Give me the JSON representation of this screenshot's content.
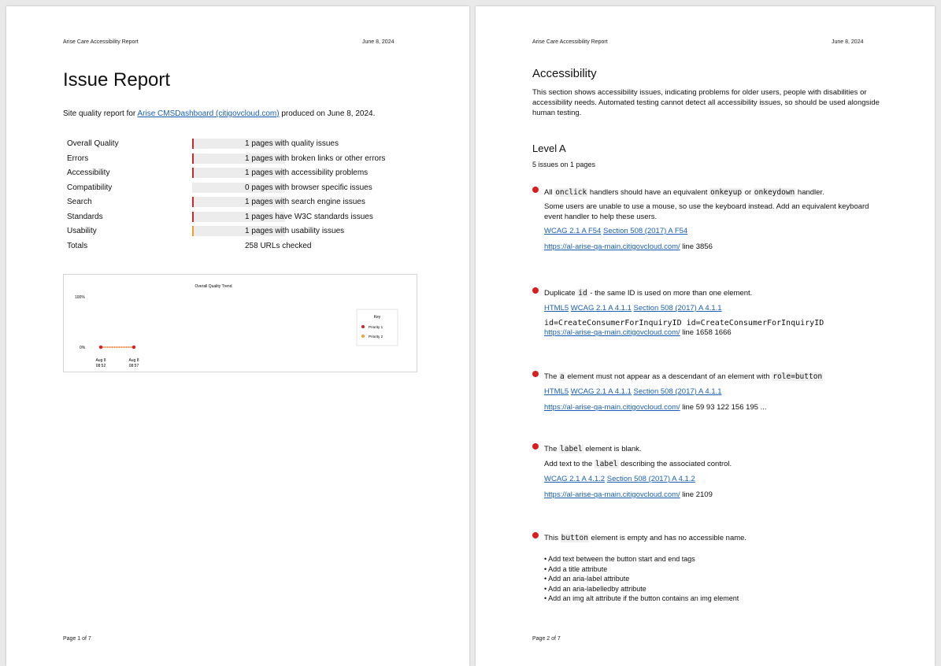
{
  "page1": {
    "header_title": "Arise Care Accessibility Report",
    "header_date": "June 8, 2024",
    "title": "Issue Report",
    "intro_prefix": "Site quality report for ",
    "intro_link": "Arise CMSDashboard (citigovcloud.com)",
    "intro_suffix": " produced on June 8, 2024.",
    "quality_rows": [
      {
        "label": "Overall Quality",
        "desc": "1 pages with quality issues",
        "marker_color": "#cc2a2a"
      },
      {
        "label": "Errors",
        "desc": "1 pages with broken links or other errors",
        "marker_color": "#cc2a2a"
      },
      {
        "label": "Accessibility",
        "desc": "1 pages with accessibility problems",
        "marker_color": "#cc2a2a"
      },
      {
        "label": "Compatibility",
        "desc": "0 pages with browser specific issues",
        "marker_color": ""
      },
      {
        "label": "Search",
        "desc": "1 pages with search engine issues",
        "marker_color": "#cc2a2a"
      },
      {
        "label": "Standards",
        "desc": "1 pages have W3C standards issues",
        "marker_color": "#cc2a2a"
      },
      {
        "label": "Usability",
        "desc": "1 pages with usability issues",
        "marker_color": "#f0a030"
      }
    ],
    "totals_label": "Totals",
    "totals_desc": "258 URLs checked",
    "footer": "Page 1 of 7"
  },
  "chart_data": {
    "type": "line",
    "title": "Overall Quality Trend",
    "y_tick_labels": [
      "100%",
      "0%"
    ],
    "ylim": [
      0,
      100
    ],
    "x": [
      "Aug 8 08:52",
      "Aug 8 08:57"
    ],
    "x_tick_labels": [
      [
        "Aug 8",
        "08:52"
      ],
      [
        "Aug 8",
        "08:57"
      ]
    ],
    "series": [
      {
        "name": "Priority 1",
        "values": [
          0,
          0
        ],
        "color": "#d61f1f"
      },
      {
        "name": "Priority 2",
        "values": [
          0,
          0
        ],
        "color": "#f0a030"
      }
    ],
    "legend_title": "Key",
    "legend_position": "right"
  },
  "page2": {
    "header_title": "Arise Care Accessibility Report",
    "header_date": "June 8, 2024",
    "heading": "Accessibility",
    "intro": "This section shows accessibility issues, indicating problems for older users, people with disabilities or accessibility needs. Automated testing cannot detect all accessibility issues, so should be used alongside human testing.",
    "level_heading": "Level A",
    "level_count": "5 issues on 1 pages",
    "issue1": {
      "t1": "All ",
      "c1": "onclick",
      "t2": " handlers should have an equivalent ",
      "c2": "onkeyup",
      "t3": " or ",
      "c3": "onkeydown",
      "t4": " handler.",
      "desc": "Some users are unable to use a mouse, so use the keyboard instead. Add an equivalent keyboard event handler to help these users.",
      "link1": "WCAG 2.1 A F54",
      "link2": "Section 508 (2017) A F54",
      "url": "https://al-arise-qa-main.citigovcloud.com/",
      "lines": " line 3856"
    },
    "issue2": {
      "t1": "Duplicate ",
      "c1": "id",
      "t2": " - the same ID is used on more than one element.",
      "link1": "HTML5",
      "link2": "WCAG 2.1 A 4.1.1",
      "link3": "Section 508 (2017) A 4.1.1",
      "ids": "id=CreateConsumerForInquiryID id=CreateConsumerForInquiryID",
      "url": "https://al-arise-qa-main.citigovcloud.com/",
      "lines": " line 1658 1666"
    },
    "issue3": {
      "t1": "The ",
      "c1": "a",
      "t2": " element must not appear as a descendant of an element with ",
      "c2": "role=button",
      "link1": "HTML5",
      "link2": "WCAG 2.1 A 4.1.1",
      "link3": "Section 508 (2017) A 4.1.1",
      "url": "https://al-arise-qa-main.citigovcloud.com/",
      "lines": " line 59 93 122 156 195 ..."
    },
    "issue4": {
      "t1": "The ",
      "c1": "label",
      "t2": " element is blank.",
      "d1": "Add text to the ",
      "dc": "label",
      "d2": " describing the associated control.",
      "link1": "WCAG 2.1 A 4.1.2",
      "link2": "Section 508 (2017) A 4.1.2",
      "url": "https://al-arise-qa-main.citigovcloud.com/",
      "lines": " line 2109"
    },
    "issue5": {
      "t1": "This ",
      "c1": "button",
      "t2": " element is empty and has no accessible name.",
      "bullets": [
        "Add text between the button start and end tags",
        "Add a title attribute",
        "Add an aria-label attribute",
        "Add an aria-labelledby attribute",
        "Add an img alt attribute if the button contains an img element"
      ]
    },
    "footer": "Page 2 of 7"
  }
}
